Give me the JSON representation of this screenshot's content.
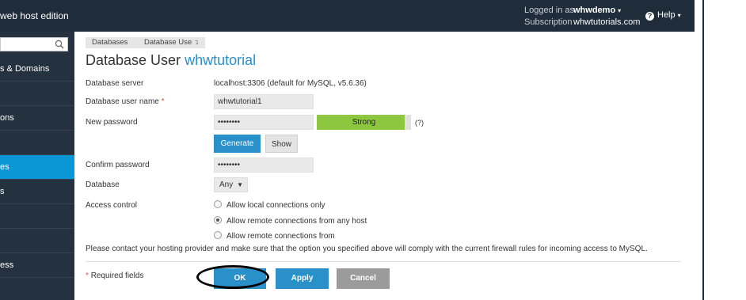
{
  "header": {
    "brand": "web host edition",
    "logged_in_label": "Logged in as",
    "logged_in_user": "whwdemo",
    "subscription_label": "Subscription",
    "subscription_value": "whwtutorials.com",
    "help_label": "Help"
  },
  "sidebar": {
    "items": [
      {
        "label": "s & Domains"
      },
      {
        "label": ""
      },
      {
        "label": "ons"
      },
      {
        "label": ""
      },
      {
        "label": "es"
      },
      {
        "label": "s"
      },
      {
        "label": ""
      },
      {
        "label": ""
      },
      {
        "label": ""
      },
      {
        "label": "ess"
      }
    ]
  },
  "breadcrumb": [
    "Databases",
    "Database Users"
  ],
  "page": {
    "title_prefix": "Database User",
    "title_name": "whwtutorial"
  },
  "form": {
    "db_server_label": "Database server",
    "db_server_value": "localhost:3306 (default for MySQL, v5.6.36)",
    "user_name_label": "Database user name",
    "user_name_value": "whwtutorial1",
    "new_password_label": "New password",
    "new_password_value": "••••••••",
    "strength_label": "Strong",
    "strength_level": 0.93,
    "strength_help": "(?)",
    "generate_label": "Generate",
    "show_label": "Show",
    "confirm_password_label": "Confirm password",
    "confirm_password_value": "••••••••",
    "database_label": "Database",
    "database_value": "Any",
    "access_control_label": "Access control",
    "access_options": [
      {
        "label": "Allow local connections only",
        "checked": false
      },
      {
        "label": "Allow remote connections from any host",
        "checked": true
      },
      {
        "label": "Allow remote connections from",
        "checked": false
      }
    ],
    "note": "Please contact your hosting provider and make sure that the option you specified above will comply with the current firewall rules for incoming access to MySQL.",
    "required_note": "Required fields",
    "required_star": "*"
  },
  "buttons": {
    "ok": "OK",
    "apply": "Apply",
    "cancel": "Cancel"
  },
  "colors": {
    "accent": "#2a90c9",
    "header_bg": "#1f2d3a",
    "sidebar_active": "#0b97d7",
    "strength_fill": "#8dc63f"
  }
}
